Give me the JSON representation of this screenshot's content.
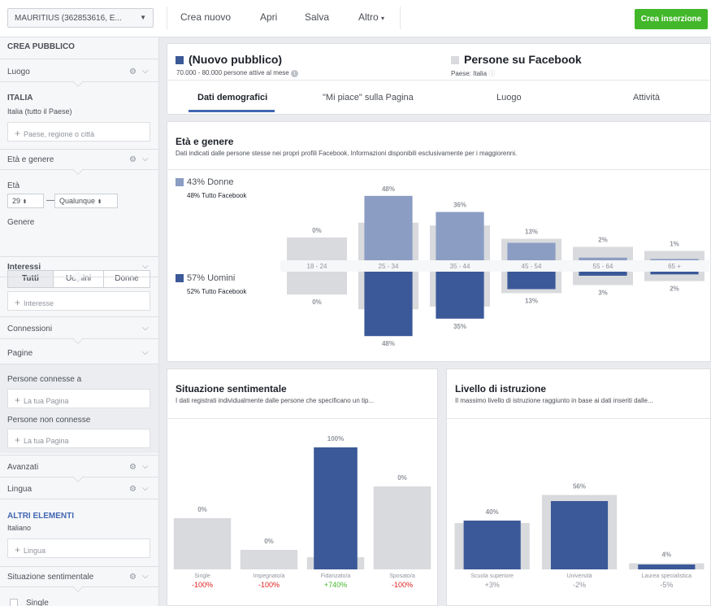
{
  "topbar": {
    "account": "MAURITIUS (362853616, E...",
    "new": "Crea nuovo",
    "open": "Apri",
    "save": "Salva",
    "more": "Altro",
    "cta": "Crea inserzione"
  },
  "sidebar": {
    "title": "CREA PUBBLICO",
    "location": "Luogo",
    "country": "ITALIA",
    "country_sub": "Italia (tutto il Paese)",
    "location_placeholder": "Paese, regione o città",
    "age_gender": "Età e genere",
    "age": "Età",
    "age_from": "29",
    "age_to": "Qualunque",
    "gender": "Genere",
    "gender_opts": [
      "Tutti",
      "Uomini",
      "Donne"
    ],
    "interests": "Interessi",
    "interest_placeholder": "Interesse",
    "connections": "Connessioni",
    "pages": "Pagine",
    "connected": "Persone connesse a",
    "not_connected": "Persone non connesse",
    "page_placeholder": "La tua Pagina",
    "advanced": "Avanzati",
    "language": "Lingua",
    "more_elements": "ALTRI ELEMENTI",
    "lang_value": "Italiano",
    "lang_placeholder": "Lingua",
    "relationship": "Situazione sentimentale",
    "single": "Single"
  },
  "header": {
    "title": "(Nuovo pubblico)",
    "subtitle": "70.000 - 80.000 persone attive al mese",
    "fb_title": "Persone su Facebook",
    "fb_sub": "Paese: Italia"
  },
  "tabs": [
    "Dati demografici",
    "\"Mi piace\" sulla Pagina",
    "Luogo",
    "Attività"
  ],
  "age_gender_card": {
    "title": "Età e genere",
    "desc": "Dati indicati dalle persone stesse nei propri profili Facebook. Informazioni disponibili esclusivamente per i maggiorenni.",
    "women": "43% Donne",
    "women_fb": "48% Tutto Facebook",
    "men": "57% Uomini",
    "men_fb": "52% Tutto Facebook"
  },
  "relationship_card": {
    "title": "Situazione sentimentale",
    "desc": "I dati registrati individualmente dalle persone che specificano un tip..."
  },
  "education_card": {
    "title": "Livello di istruzione",
    "desc": "Il massimo livello di istruzione raggiunto in base ai dati inseriti dalle..."
  },
  "colors": {
    "women": "#8b9dc3",
    "men": "#3b5998",
    "bg": "#d8dadd",
    "green": "#42b72a",
    "red": "#e02020"
  },
  "chart_data": [
    {
      "type": "bar",
      "title": "Età e genere",
      "categories": [
        "18 - 24",
        "25 - 34",
        "35 - 44",
        "45 - 54",
        "55 - 64",
        "65 +"
      ],
      "series": [
        {
          "name": "Donne",
          "values": [
            0,
            48,
            36,
            13,
            2,
            1
          ],
          "labels": [
            "0%",
            "48%",
            "36%",
            "13%",
            "2%",
            "1%"
          ],
          "facebook": [
            17,
            28,
            26,
            16,
            10,
            7
          ]
        },
        {
          "name": "Uomini",
          "values": [
            0,
            48,
            35,
            13,
            3,
            2
          ],
          "labels": [
            "0%",
            "48%",
            "35%",
            "13%",
            "3%",
            "2%"
          ],
          "facebook": [
            17,
            28,
            26,
            16,
            10,
            7
          ]
        }
      ]
    },
    {
      "type": "bar",
      "title": "Situazione sentimentale",
      "categories": [
        "Single",
        "Impegnato/a",
        "Fidanzato/a",
        "Sposato/a"
      ],
      "values": [
        0,
        0,
        100,
        0
      ],
      "labels": [
        "0%",
        "0%",
        "100%",
        "0%"
      ],
      "facebook": [
        42,
        16,
        10,
        68
      ],
      "diff": [
        "-100%",
        "-100%",
        "+740%",
        "-100%"
      ]
    },
    {
      "type": "bar",
      "title": "Livello di istruzione",
      "categories": [
        "Scuola superiore",
        "Università",
        "Laurea specialistica"
      ],
      "values": [
        40,
        56,
        4
      ],
      "labels": [
        "40%",
        "56%",
        "4%"
      ],
      "facebook": [
        38,
        61,
        5
      ],
      "diff": [
        "+3%",
        "-2%",
        "-5%"
      ]
    }
  ]
}
